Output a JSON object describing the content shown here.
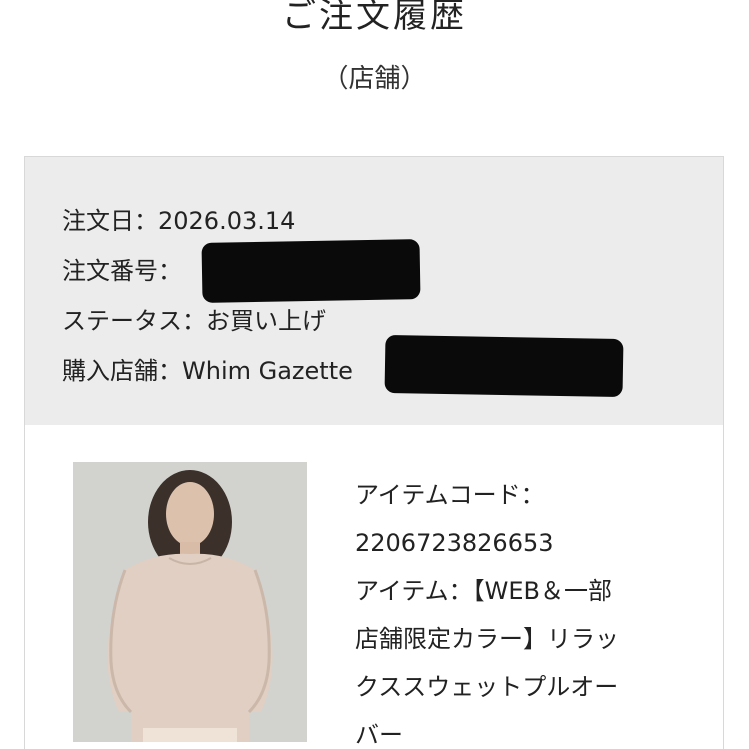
{
  "header": {
    "title": "ご注文履歴",
    "subtitle": "（店舗）"
  },
  "order": {
    "date_label": "注文日：",
    "date_value": "2026.03.14",
    "number_label": "注文番号：",
    "status_label": "ステータス：",
    "status_value": "お買い上げ",
    "store_label": "購入店舗：",
    "store_value": "Whim Gazette"
  },
  "item": {
    "code_label": "アイテムコード：",
    "code_value": "2206723826653",
    "name_label": "アイテム：",
    "name_lines": [
      "【WEB＆一部",
      "店舗限定カラー】リラッ",
      "クススウェットプルオー",
      "バー"
    ],
    "photo_icon": "product-photo"
  }
}
